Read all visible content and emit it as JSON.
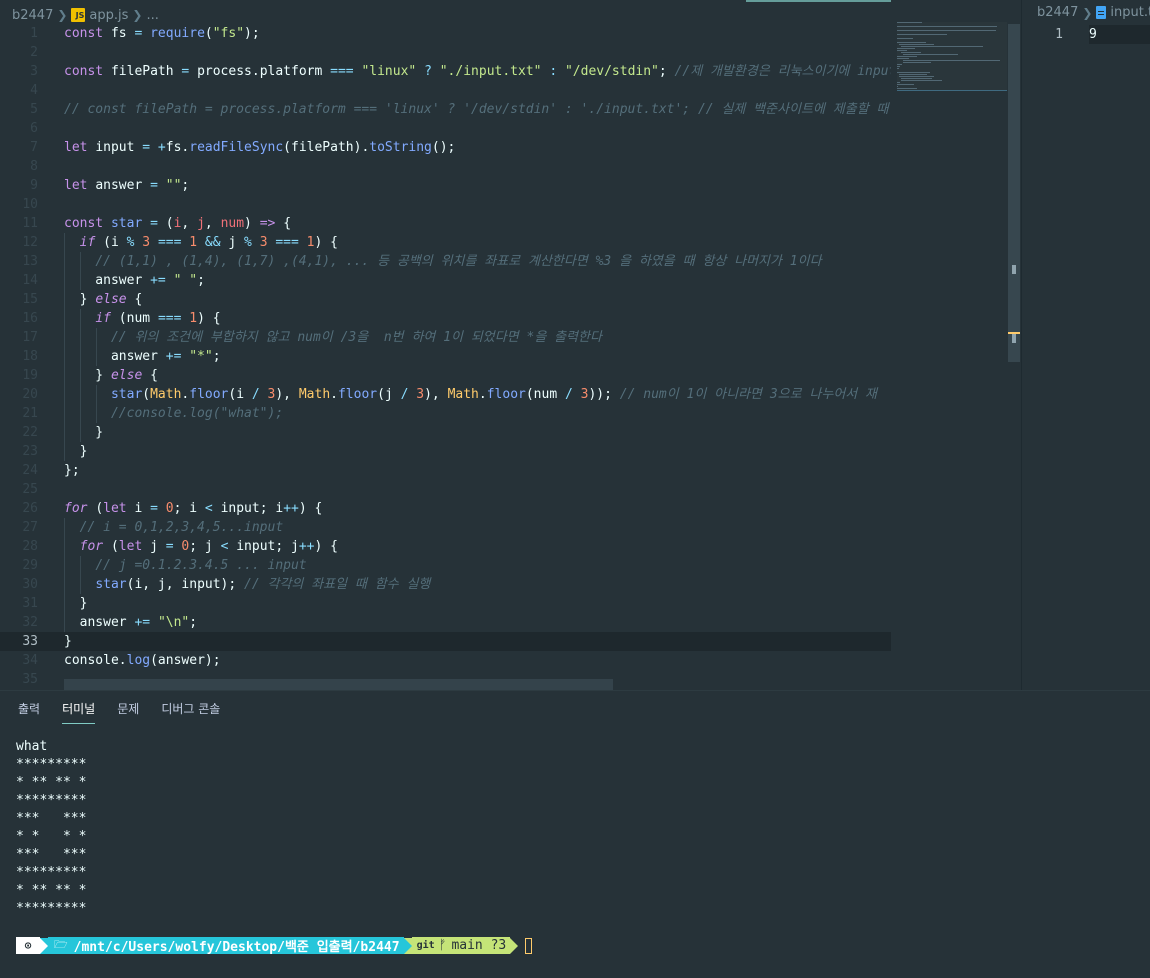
{
  "left_editor": {
    "breadcrumb": {
      "folder": "b2447",
      "file": "app.js",
      "more": "..."
    },
    "current_line": 33,
    "lines": [
      {
        "n": "1",
        "t": [
          [
            "k",
            "const "
          ],
          [
            "id",
            "fs "
          ],
          [
            "o",
            "= "
          ],
          [
            "f",
            "require"
          ],
          [
            "id",
            "("
          ],
          [
            "s",
            "\"fs\""
          ],
          [
            "id",
            ");"
          ]
        ]
      },
      {
        "n": "2",
        "t": []
      },
      {
        "n": "3",
        "t": [
          [
            "k",
            "const "
          ],
          [
            "id",
            "filePath "
          ],
          [
            "o",
            "= "
          ],
          [
            "id",
            "process.platform "
          ],
          [
            "o",
            "=== "
          ],
          [
            "s",
            "\"linux\" "
          ],
          [
            "o",
            "? "
          ],
          [
            "s",
            "\"./input.txt\" "
          ],
          [
            "o",
            ": "
          ],
          [
            "s",
            "\"/dev/stdin\""
          ],
          [
            "id",
            "; "
          ],
          [
            "c",
            "//제 개발환경은 리눅스이기에 input"
          ]
        ]
      },
      {
        "n": "4",
        "t": []
      },
      {
        "n": "5",
        "t": [
          [
            "c",
            "// const filePath = process.platform === 'linux' ? '/dev/stdin' : './input.txt'; // 실제 백준사이트에 제출할 때"
          ]
        ]
      },
      {
        "n": "6",
        "t": []
      },
      {
        "n": "7",
        "t": [
          [
            "k",
            "let "
          ],
          [
            "id",
            "input "
          ],
          [
            "o",
            "= +"
          ],
          [
            "id",
            "fs."
          ],
          [
            "f",
            "readFileSync"
          ],
          [
            "id",
            "(filePath)."
          ],
          [
            "f",
            "toString"
          ],
          [
            "id",
            "();"
          ]
        ]
      },
      {
        "n": "8",
        "t": []
      },
      {
        "n": "9",
        "t": [
          [
            "k",
            "let "
          ],
          [
            "id",
            "answer "
          ],
          [
            "o",
            "= "
          ],
          [
            "s",
            "\"\""
          ],
          [
            "id",
            ";"
          ]
        ]
      },
      {
        "n": "10",
        "t": []
      },
      {
        "n": "11",
        "t": [
          [
            "k",
            "const "
          ],
          [
            "f",
            "star "
          ],
          [
            "o",
            "= "
          ],
          [
            "id",
            "("
          ],
          [
            "p",
            "i"
          ],
          [
            "id",
            ", "
          ],
          [
            "p",
            "j"
          ],
          [
            "id",
            ", "
          ],
          [
            "p",
            "num"
          ],
          [
            "id",
            ") "
          ],
          [
            "k",
            "=> "
          ],
          [
            "id",
            "{"
          ]
        ]
      },
      {
        "n": "12",
        "t": [
          [
            "id",
            "  "
          ],
          [
            "ki",
            "if "
          ],
          [
            "id",
            "(i "
          ],
          [
            "o",
            "% "
          ],
          [
            "n",
            "3 "
          ],
          [
            "o",
            "=== "
          ],
          [
            "n",
            "1 "
          ],
          [
            "o",
            "&& "
          ],
          [
            "id",
            "j "
          ],
          [
            "o",
            "% "
          ],
          [
            "n",
            "3 "
          ],
          [
            "o",
            "=== "
          ],
          [
            "n",
            "1"
          ],
          [
            "id",
            ") {"
          ]
        ]
      },
      {
        "n": "13",
        "t": [
          [
            "id",
            "    "
          ],
          [
            "c",
            "// (1,1) , (1,4), (1,7) ,(4,1), ... 등 공백의 위치를 좌표로 계산한다면 %3 을 하였을 때 항상 나머지가 1이다"
          ]
        ]
      },
      {
        "n": "14",
        "t": [
          [
            "id",
            "    answer "
          ],
          [
            "o",
            "+= "
          ],
          [
            "s",
            "\" \""
          ],
          [
            "id",
            ";"
          ]
        ]
      },
      {
        "n": "15",
        "t": [
          [
            "id",
            "  } "
          ],
          [
            "ki",
            "else "
          ],
          [
            "id",
            "{"
          ]
        ]
      },
      {
        "n": "16",
        "t": [
          [
            "id",
            "    "
          ],
          [
            "ki",
            "if "
          ],
          [
            "id",
            "(num "
          ],
          [
            "o",
            "=== "
          ],
          [
            "n",
            "1"
          ],
          [
            "id",
            ") {"
          ]
        ]
      },
      {
        "n": "17",
        "t": [
          [
            "id",
            "      "
          ],
          [
            "c",
            "// 위의 조건에 부합하지 않고 num이 /3을  n번 하여 1이 되었다면 *을 출력한다"
          ]
        ]
      },
      {
        "n": "18",
        "t": [
          [
            "id",
            "      answer "
          ],
          [
            "o",
            "+= "
          ],
          [
            "s",
            "\"*\""
          ],
          [
            "id",
            ";"
          ]
        ]
      },
      {
        "n": "19",
        "t": [
          [
            "id",
            "    } "
          ],
          [
            "ki",
            "else "
          ],
          [
            "id",
            "{"
          ]
        ]
      },
      {
        "n": "20",
        "t": [
          [
            "id",
            "      "
          ],
          [
            "f",
            "star"
          ],
          [
            "id",
            "("
          ],
          [
            "b",
            "Math"
          ],
          [
            "id",
            "."
          ],
          [
            "f",
            "floor"
          ],
          [
            "id",
            "(i "
          ],
          [
            "o",
            "/ "
          ],
          [
            "n",
            "3"
          ],
          [
            "id",
            "), "
          ],
          [
            "b",
            "Math"
          ],
          [
            "id",
            "."
          ],
          [
            "f",
            "floor"
          ],
          [
            "id",
            "(j "
          ],
          [
            "o",
            "/ "
          ],
          [
            "n",
            "3"
          ],
          [
            "id",
            "), "
          ],
          [
            "b",
            "Math"
          ],
          [
            "id",
            "."
          ],
          [
            "f",
            "floor"
          ],
          [
            "id",
            "(num "
          ],
          [
            "o",
            "/ "
          ],
          [
            "n",
            "3"
          ],
          [
            "id",
            "));"
          ],
          [
            "c",
            " // num이 1이 아니라면 3으로 나누어서 재"
          ]
        ]
      },
      {
        "n": "21",
        "t": [
          [
            "id",
            "      "
          ],
          [
            "c",
            "//console.log(\"what\");"
          ]
        ]
      },
      {
        "n": "22",
        "t": [
          [
            "id",
            "    }"
          ]
        ]
      },
      {
        "n": "23",
        "t": [
          [
            "id",
            "  }"
          ]
        ]
      },
      {
        "n": "24",
        "t": [
          [
            "id",
            "};"
          ]
        ]
      },
      {
        "n": "25",
        "t": []
      },
      {
        "n": "26",
        "t": [
          [
            "ki",
            "for "
          ],
          [
            "id",
            "("
          ],
          [
            "k",
            "let "
          ],
          [
            "id",
            "i "
          ],
          [
            "o",
            "= "
          ],
          [
            "n",
            "0"
          ],
          [
            "id",
            "; i "
          ],
          [
            "o",
            "< "
          ],
          [
            "id",
            "input; i"
          ],
          [
            "o",
            "++"
          ],
          [
            "id",
            ") {"
          ]
        ]
      },
      {
        "n": "27",
        "t": [
          [
            "id",
            "  "
          ],
          [
            "c",
            "// i = 0,1,2,3,4,5...input"
          ]
        ]
      },
      {
        "n": "28",
        "t": [
          [
            "id",
            "  "
          ],
          [
            "ki",
            "for "
          ],
          [
            "id",
            "("
          ],
          [
            "k",
            "let "
          ],
          [
            "id",
            "j "
          ],
          [
            "o",
            "= "
          ],
          [
            "n",
            "0"
          ],
          [
            "id",
            "; j "
          ],
          [
            "o",
            "< "
          ],
          [
            "id",
            "input; j"
          ],
          [
            "o",
            "++"
          ],
          [
            "id",
            ") {"
          ]
        ]
      },
      {
        "n": "29",
        "t": [
          [
            "id",
            "    "
          ],
          [
            "c",
            "// j =0.1.2.3.4.5 ... input"
          ]
        ]
      },
      {
        "n": "30",
        "t": [
          [
            "id",
            "    "
          ],
          [
            "f",
            "star"
          ],
          [
            "id",
            "(i, j, input); "
          ],
          [
            "c",
            "// 각각의 좌표일 때 함수 실행"
          ]
        ]
      },
      {
        "n": "31",
        "t": [
          [
            "id",
            "  }"
          ]
        ]
      },
      {
        "n": "32",
        "t": [
          [
            "id",
            "  answer "
          ],
          [
            "o",
            "+= "
          ],
          [
            "s",
            "\"\\n\""
          ],
          [
            "id",
            ";"
          ]
        ]
      },
      {
        "n": "33",
        "t": [
          [
            "id",
            "}"
          ]
        ]
      },
      {
        "n": "34",
        "t": [
          [
            "id",
            "console."
          ],
          [
            "f",
            "log"
          ],
          [
            "id",
            "(answer);"
          ]
        ]
      },
      {
        "n": "35",
        "t": []
      }
    ]
  },
  "right_editor": {
    "breadcrumb": {
      "folder": "b2447",
      "file": "input.txt"
    },
    "line_number": "1",
    "line_text": "9"
  },
  "panel": {
    "tabs": [
      {
        "label": "출력",
        "active": false
      },
      {
        "label": "터미널",
        "active": true
      },
      {
        "label": "문제",
        "active": false
      },
      {
        "label": "디버그 콘솔",
        "active": false
      }
    ],
    "terminal_output": [
      "what",
      "*********",
      "* ** ** *",
      "*********",
      "***   ***",
      "* *   * *",
      "***   ***",
      "*********",
      "* ** ** *",
      "*********"
    ],
    "prompt": {
      "os_icon": "linux-icon",
      "folder_glyph": "🗁",
      "path": "/mnt/c/Users/wolfy/Desktop/백준 입출력/b2447",
      "git_label": "git",
      "branch_glyph": "ᚠ",
      "branch": "main ?3"
    }
  },
  "colors": {
    "background": "#263238",
    "keyword": "#c792ea",
    "function": "#82aaff",
    "string": "#c3e88d",
    "number": "#f78c6c",
    "comment": "#546e7a",
    "prompt_path": "#26c6da",
    "prompt_git": "#c5e478"
  }
}
